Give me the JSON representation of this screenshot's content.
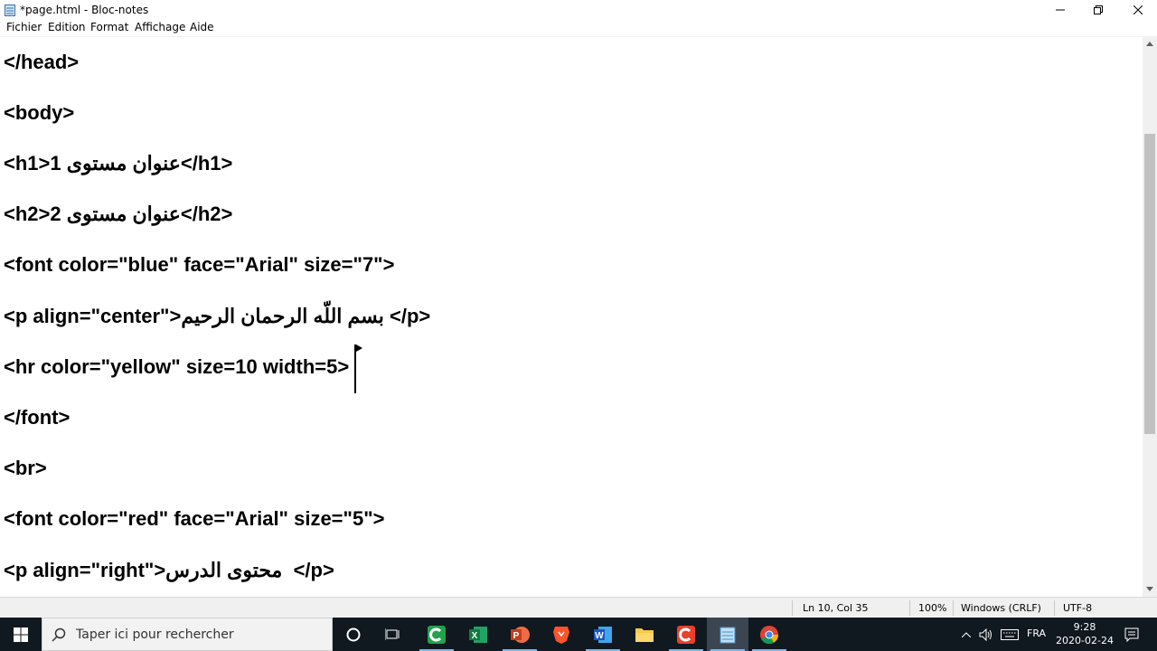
{
  "window": {
    "title": "*page.html - Bloc-notes"
  },
  "menu": {
    "items": [
      "Fichier",
      "Edition",
      "Format",
      "Affichage",
      "Aide"
    ]
  },
  "editor": {
    "lines": [
      "</head>",
      "<body>",
      "<h1>عنوان مستوى 1</h1>",
      "<h2>عنوان مستوى 2</h2>",
      "<font color=\"blue\" face=\"Arial\" size=\"7\">",
      "<p align=\"center\">بسم اللّه الرحمان الرحيم </p>",
      "<hr color=\"yellow\" size=10 width=5>",
      "</font>",
      "<br>",
      "<font color=\"red\" face=\"Arial\" size=\"5\">",
      "<p align=\"right\">محتوى الدرس  </p>"
    ]
  },
  "status": {
    "position": "Ln 10, Col 35",
    "zoom": "100%",
    "line_ending": "Windows (CRLF)",
    "encoding": "UTF-8"
  },
  "taskbar": {
    "search_placeholder": "Taper ici pour rechercher",
    "language": "FRA",
    "time": "9:28",
    "date": "2020-02-24",
    "apps": [
      "cortana-icon",
      "task-view-icon",
      "camtasia-icon",
      "excel-icon",
      "powerpoint-icon",
      "brave-icon",
      "word-icon",
      "file-explorer-icon",
      "camtasia-recorder-icon",
      "notepad-icon",
      "chrome-icon"
    ]
  },
  "colors": {
    "taskbar_bg": "#101820",
    "accent": "#76b9ed"
  }
}
